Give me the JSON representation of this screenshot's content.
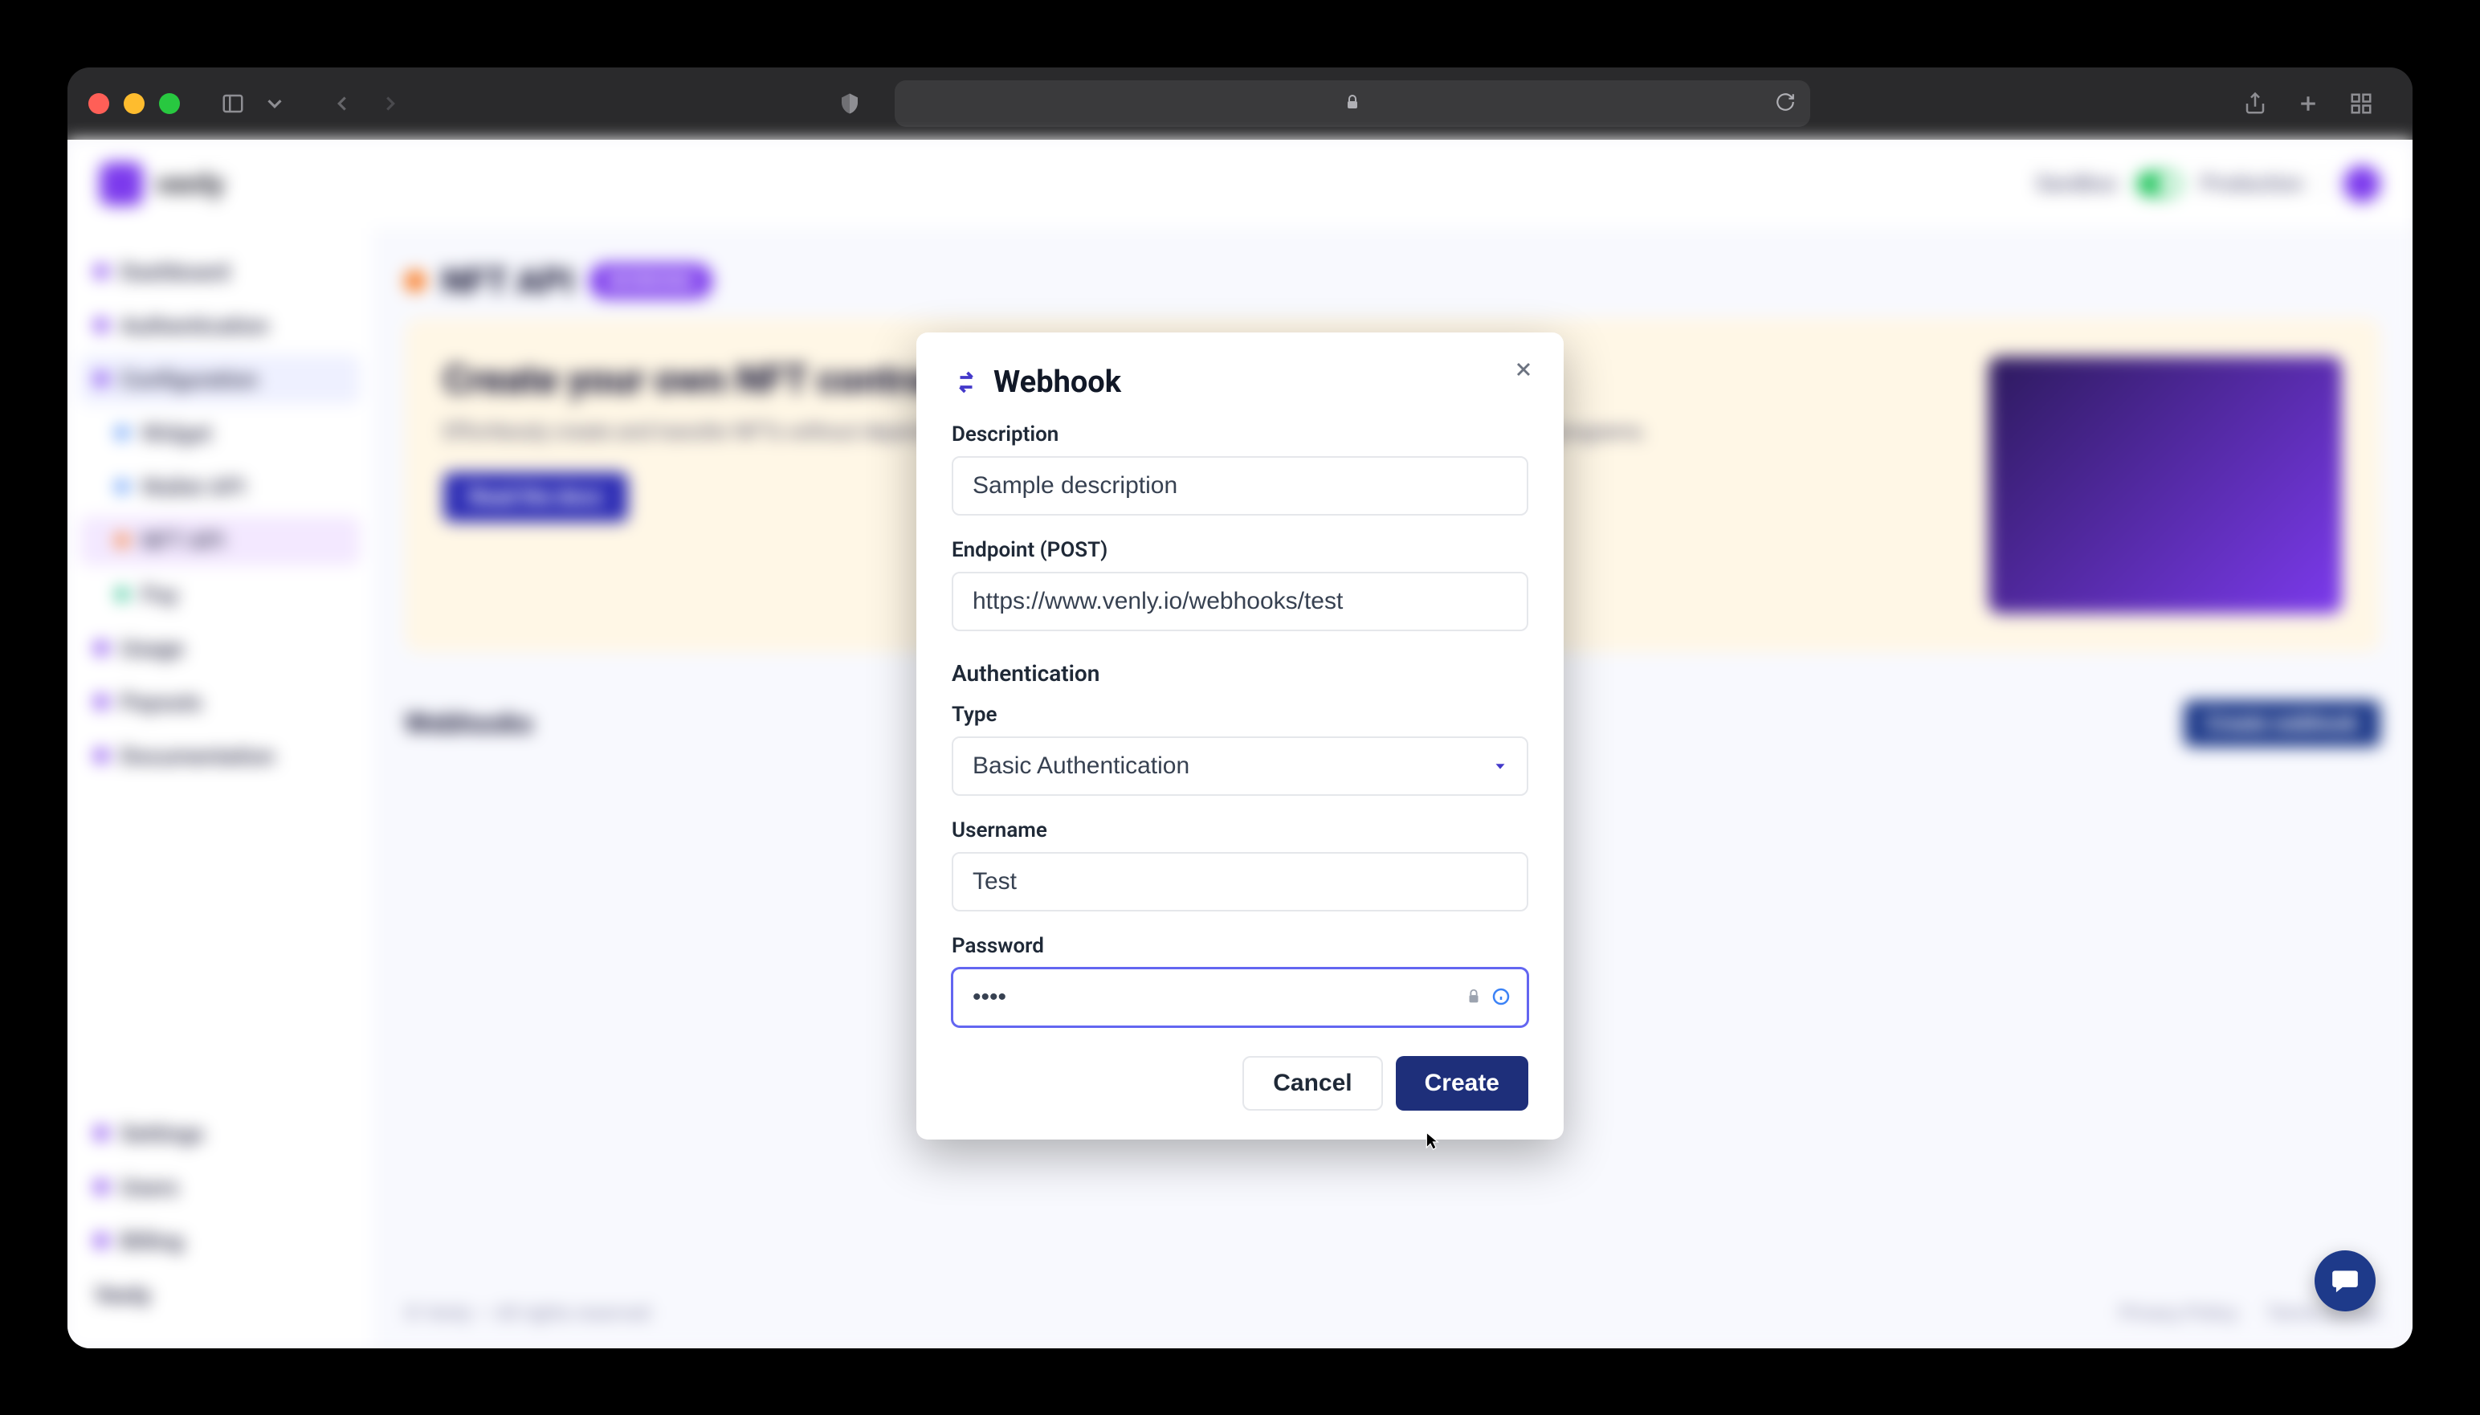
{
  "browser": {
    "shield_tooltip": "Privacy",
    "share_tooltip": "Share",
    "newtab_tooltip": "New Tab",
    "tabs_tooltip": "Tab Overview"
  },
  "app": {
    "brand": "venly",
    "sidebar": {
      "dashboard": "Dashboard",
      "authentication": "Authentication",
      "configuration": "Configuration",
      "widget": "Widget",
      "wallet_api": "Wallet API",
      "nft_api": "NFT API",
      "pay": "Pay",
      "usage": "Usage",
      "payouts": "Payouts",
      "documentation": "Documentation",
      "settings": "Settings",
      "users": "Users",
      "billing": "Billing",
      "company": "Venly"
    },
    "page": {
      "title": "NFT API",
      "badge": "WORKING"
    },
    "header_right": {
      "sandbox": "Sandbox",
      "production": "Production"
    },
    "hero": {
      "heading": "Create your own NFT contracts",
      "body": "Effortlessly create and transfer NFTs without depending the users' wallets. Great for collectibles, certificates and loyalty programs.",
      "button": "Read the docs"
    },
    "webhooks": {
      "section_title": "Webhooks",
      "create_button": "Create webhook"
    },
    "footer": {
      "copyright": "© Venly — All rights reserved",
      "privacy": "Privacy Policy",
      "terms": "Terms of Use"
    }
  },
  "modal": {
    "title": "Webhook",
    "fields": {
      "description": {
        "label": "Description",
        "value": "Sample description"
      },
      "endpoint": {
        "label": "Endpoint (POST)",
        "value": "https://www.venly.io/webhooks/test"
      },
      "auth_section": "Authentication",
      "type": {
        "label": "Type",
        "value": "Basic Authentication"
      },
      "username": {
        "label": "Username",
        "value": "Test"
      },
      "password": {
        "label": "Password",
        "value": "••••"
      }
    },
    "actions": {
      "cancel": "Cancel",
      "create": "Create"
    }
  }
}
